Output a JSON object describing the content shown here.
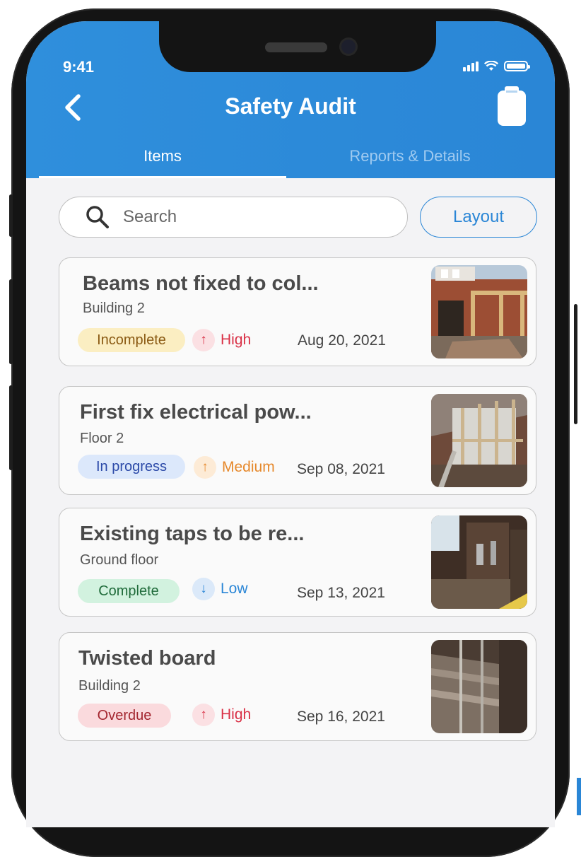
{
  "status_bar": {
    "time": "9:41"
  },
  "header": {
    "title": "Safety Audit"
  },
  "tabs": [
    {
      "label": "Items"
    },
    {
      "label": "Reports & Details"
    }
  ],
  "search": {
    "placeholder": "Search"
  },
  "layout_button": {
    "label": "Layout"
  },
  "colors": {
    "accent": "#2a86d6",
    "background": "#f3f3f5"
  },
  "items": [
    {
      "title": "Beams not fixed to col...",
      "location": "Building 2",
      "status": "Incomplete",
      "priority": "High",
      "priority_icon": "arrow-up-icon",
      "date": "Aug 20, 2021"
    },
    {
      "title": "First fix electrical pow...",
      "location": "Floor 2",
      "status": "In progress",
      "priority": "Medium",
      "priority_icon": "arrow-up-icon",
      "date": "Sep 08, 2021"
    },
    {
      "title": "Existing taps to be re...",
      "location": "Ground floor",
      "status": "Complete",
      "priority": "Low",
      "priority_icon": "arrow-down-icon",
      "date": "Sep 13, 2021"
    },
    {
      "title": "Twisted board",
      "location": "Building 2",
      "status": "Overdue",
      "priority": "High",
      "priority_icon": "arrow-up-icon",
      "date": "Sep 16, 2021"
    }
  ]
}
